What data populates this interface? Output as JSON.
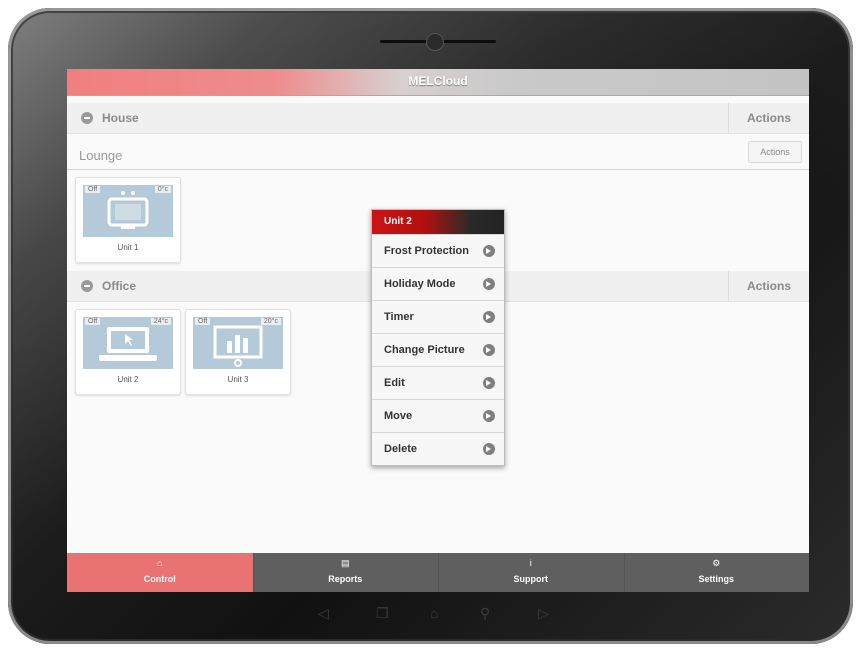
{
  "app": {
    "title": "MELCloud"
  },
  "groups": [
    {
      "name": "House",
      "actions_label": "Actions"
    },
    {
      "name": "Office",
      "actions_label": "Actions"
    }
  ],
  "room": {
    "name": "Lounge",
    "actions_label": "Actions"
  },
  "units": [
    {
      "name": "Unit 1",
      "status": "Off",
      "temp": "0°c"
    },
    {
      "name": "Unit 2",
      "status": "Off",
      "temp": "24°c"
    },
    {
      "name": "Unit 3",
      "status": "Off",
      "temp": "20°c"
    }
  ],
  "context_menu": {
    "title": "Unit 2",
    "items": [
      "Frost Protection",
      "Holiday Mode",
      "Timer",
      "Change Picture",
      "Edit",
      "Move",
      "Delete"
    ]
  },
  "tabs": [
    {
      "label": "Control",
      "icon": "home-icon"
    },
    {
      "label": "Reports",
      "icon": "list-icon"
    },
    {
      "label": "Support",
      "icon": "info-icon"
    },
    {
      "label": "Settings",
      "icon": "gear-icon"
    }
  ],
  "colors": {
    "accent": "#e97373",
    "menu_header": "#cc1414",
    "tabbar": "#5f5f5f"
  }
}
